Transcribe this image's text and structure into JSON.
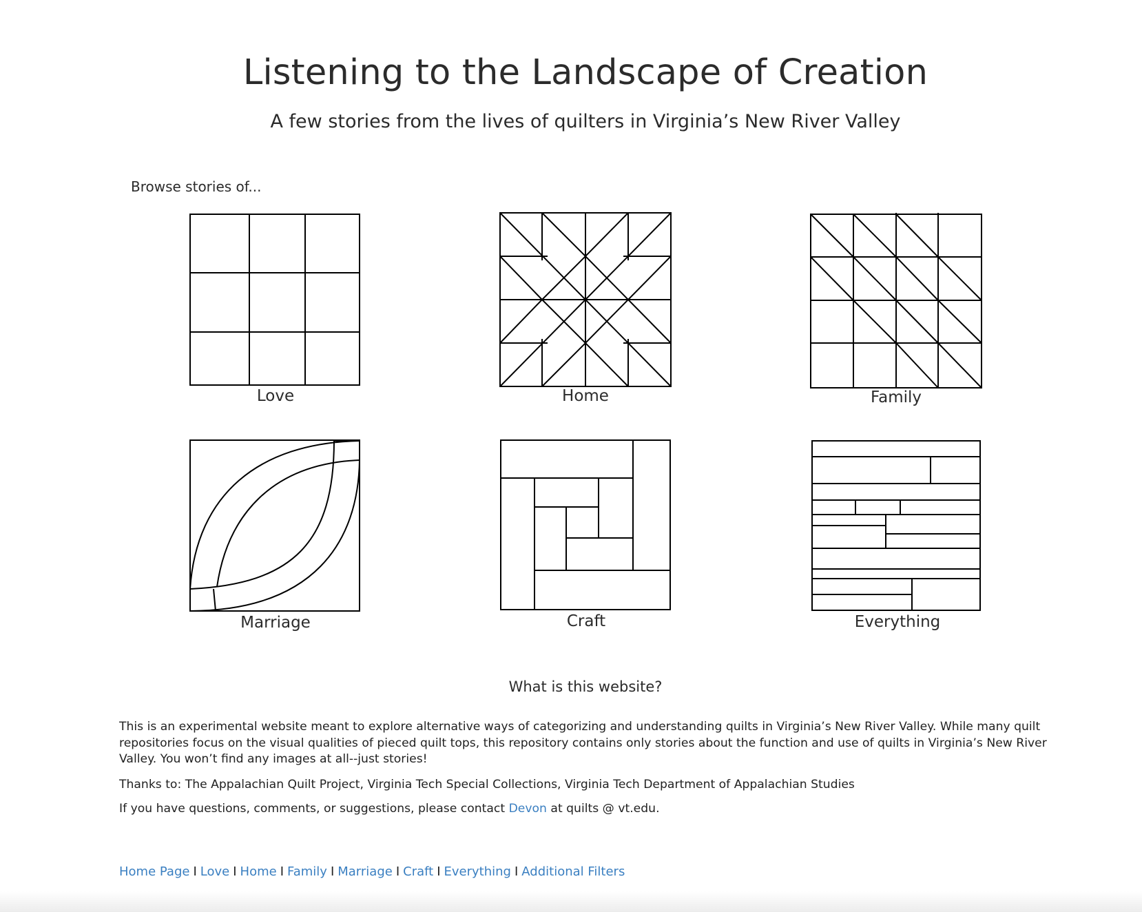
{
  "header": {
    "title": "Listening to the Landscape of Creation",
    "subtitle": "A few stories from the lives of quilters in Virginia’s New River Valley"
  },
  "browse": {
    "label": "Browse stories of...",
    "tiles": [
      {
        "label": "Love",
        "icon": "nine-patch-quilt-block-icon"
      },
      {
        "label": "Home",
        "icon": "eight-point-star-quilt-block-icon"
      },
      {
        "label": "Family",
        "icon": "half-square-triangles-quilt-block-icon"
      },
      {
        "label": "Marriage",
        "icon": "double-wedding-ring-quilt-block-icon"
      },
      {
        "label": "Craft",
        "icon": "log-cabin-quilt-block-icon"
      },
      {
        "label": "Everything",
        "icon": "strip-pieced-quilt-block-icon"
      }
    ]
  },
  "about": {
    "heading": "What is this website?",
    "paragraph": "This is an experimental website meant to explore alternative ways of categorizing and understanding quilts in Virginia’s New River Valley. While many quilt repositories focus on the visual qualities of pieced quilt tops, this repository contains only stories about the function and use of quilts in Virginia’s New River Valley. You won’t find any images at all--just stories!",
    "thanks": "Thanks to: The Appalachian Quilt Project, Virginia Tech Special Collections, Virginia Tech Department of Appalachian Studies",
    "contact_before": "If you have questions, comments, or suggestions, please contact ",
    "contact_link": "Devon",
    "contact_after": " at quilts @ vt.edu."
  },
  "footer": {
    "links": [
      "Home Page",
      "Love",
      "Home",
      "Family",
      "Marriage",
      "Craft",
      "Everything",
      "Additional Filters"
    ],
    "separator": "I"
  },
  "colors": {
    "text": "#2b2b2b",
    "link": "#3a7fc1",
    "line": "#000000"
  }
}
